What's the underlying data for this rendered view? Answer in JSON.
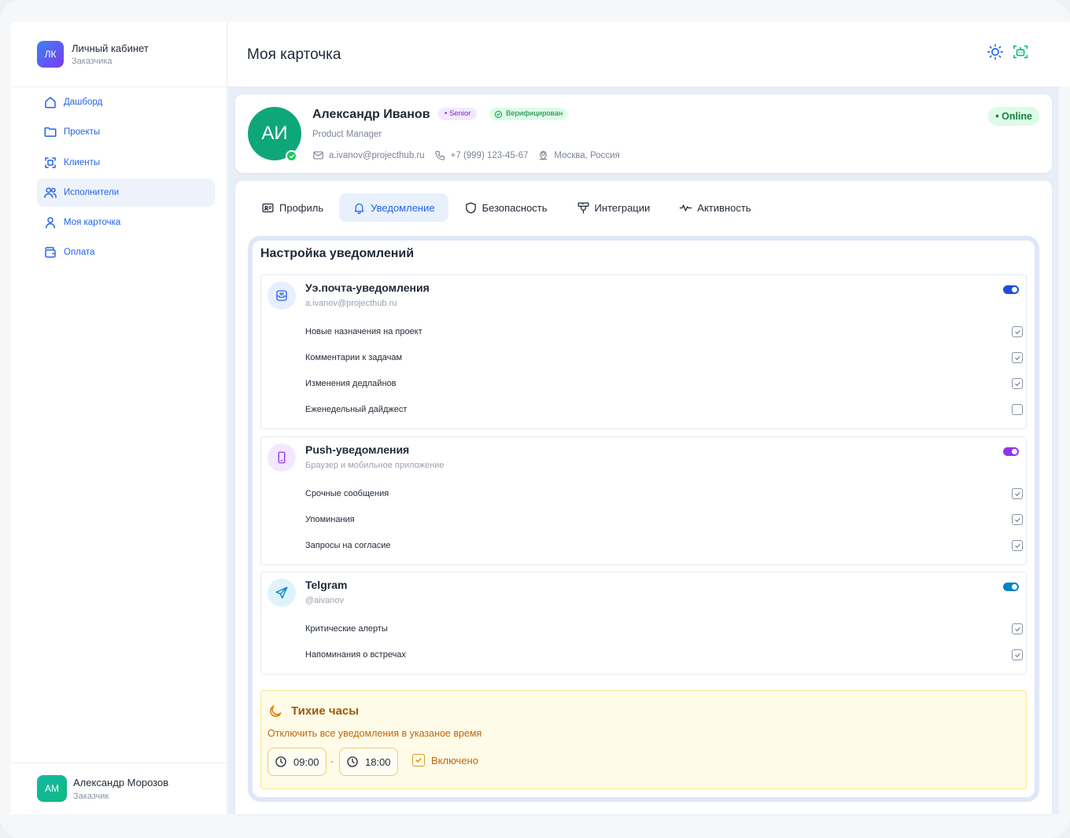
{
  "brand": {
    "logo": "ЛК",
    "title": "Личный кабинет",
    "subtitle": "Заказчика"
  },
  "nav": [
    {
      "label": "Дашборд",
      "icon": "home-icon"
    },
    {
      "label": "Проекты",
      "icon": "folder-icon"
    },
    {
      "label": "Клиенты",
      "icon": "clients-icon"
    },
    {
      "label": "Исполнители",
      "icon": "users-icon",
      "active": true
    },
    {
      "label": "Моя карточка",
      "icon": "user-icon"
    },
    {
      "label": "Оплата",
      "icon": "wallet-icon"
    }
  ],
  "user": {
    "initials": "АМ",
    "name": "Александр Морозов",
    "role": "Заказчик"
  },
  "header": {
    "title": "Моя карточка",
    "icons": [
      "sun-icon",
      "bot-icon"
    ]
  },
  "profile": {
    "initials": "АИ",
    "name": "Александр Иванов",
    "level": "• Senior",
    "verified": "Верифицирован",
    "role": "Product Manager",
    "email": "a.ivanov@projecthub.ru",
    "phone": "+7 (999) 123-45-67",
    "location": "Москва, Россия",
    "status": "• Online"
  },
  "tabs": [
    {
      "label": "Профиль",
      "icon": "id-card-icon"
    },
    {
      "label": "Уведомление",
      "icon": "bell-icon",
      "active": true
    },
    {
      "label": "Безопасность",
      "icon": "shield-icon"
    },
    {
      "label": "Интеграции",
      "icon": "plug-icon"
    },
    {
      "label": "Активность",
      "icon": "activity-icon"
    }
  ],
  "notifications": {
    "title": "Настройка уведомлений",
    "sections": [
      {
        "title": "Уэ.почта-уведомления",
        "subtitle": "a.ivanov@projecthub.ru",
        "icon": "mail-inbox-icon",
        "enabled": true,
        "toggle_color": "#1d4ed8",
        "items": [
          {
            "label": "Новые назначения на проект",
            "checked": true
          },
          {
            "label": "Комментарии к задачам",
            "checked": true
          },
          {
            "label": "Изменения дедлайнов",
            "checked": true
          },
          {
            "label": "Еженедельный дайджест",
            "checked": false
          }
        ]
      },
      {
        "title": "Push-уведомления",
        "subtitle": "Браузер и мобильное приложение",
        "icon": "smartphone-icon",
        "enabled": true,
        "toggle_color": "#9333ea",
        "items": [
          {
            "label": "Срочные сообщения",
            "checked": true
          },
          {
            "label": "Упоминания",
            "checked": true
          },
          {
            "label": "Запросы на согласие",
            "checked": true
          }
        ]
      },
      {
        "title": "Telgram",
        "subtitle": "@aivanov",
        "icon": "send-icon",
        "enabled": true,
        "toggle_color": "#0284c7",
        "items": [
          {
            "label": "Критические алерты",
            "checked": true
          },
          {
            "label": "Напоминания о встречах",
            "checked": true
          }
        ]
      }
    ]
  },
  "quiet_hours": {
    "title": "Тихие часы",
    "subtitle": "Отключить все уведомления в указаное время",
    "start": "09:00",
    "separator": "-",
    "end": "18:00",
    "enabled_label": "Включено",
    "enabled": true
  },
  "colors": {
    "accent": "#2563eb",
    "online": "#15803d",
    "quiet": "#c2650a"
  }
}
